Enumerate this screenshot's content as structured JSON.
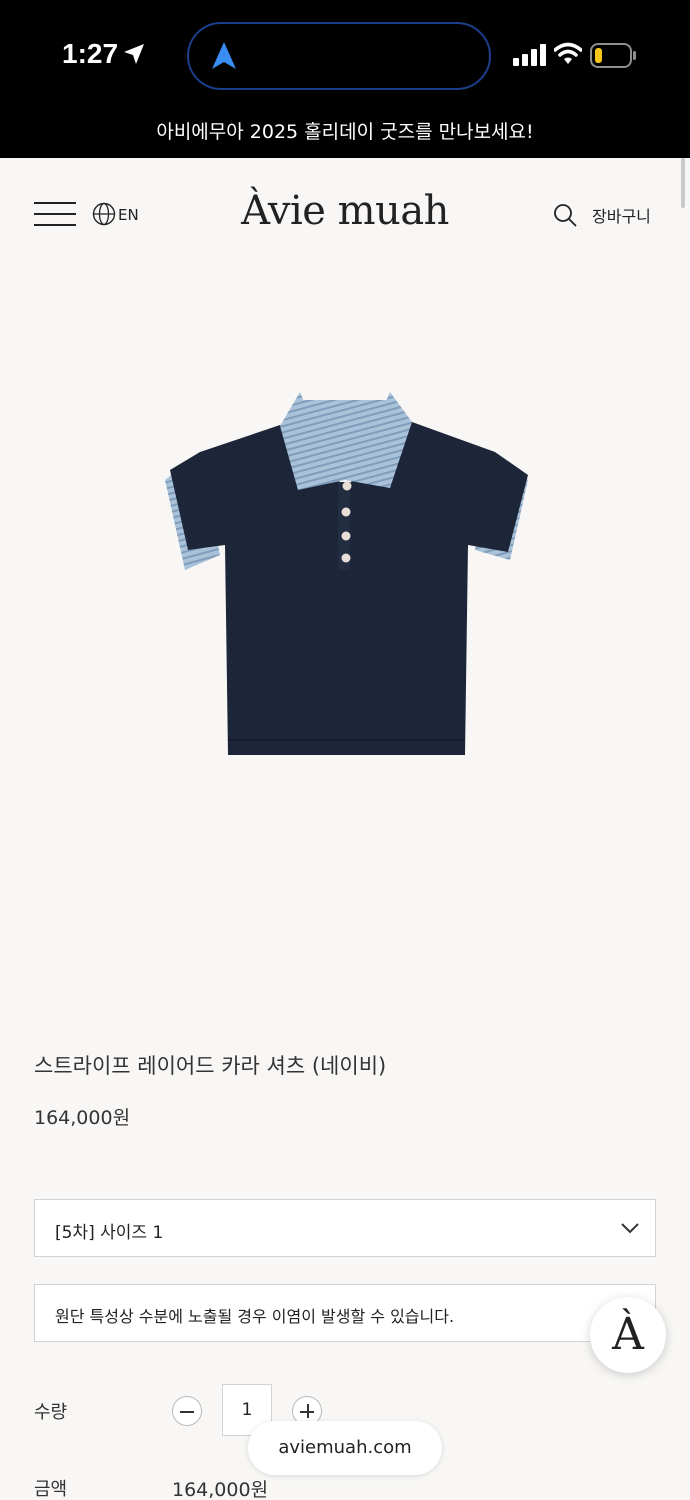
{
  "status_bar": {
    "time": "1:27",
    "icons": [
      "location-arrow-icon",
      "maps-arrow-icon",
      "signal-icon",
      "wifi-icon",
      "battery-icon"
    ]
  },
  "announcement": "아비에무아 2025 홀리데이 굿즈를 만나보세요!",
  "header": {
    "language": "EN",
    "logo": "Àvie muah",
    "cart": "장바구니"
  },
  "product": {
    "name": "스트라이프 레이어드 카라 셔츠 (네이비)",
    "price": "164,000원",
    "option_selected": "[5차] 사이즈 1",
    "notice": "원단 특성상 수분에 노출될 경우 이염이 발생할 수 있습니다."
  },
  "quantity": {
    "label": "수량",
    "value": "1"
  },
  "total": {
    "label": "금액",
    "value": "164,000원"
  },
  "fab_logo": "À",
  "url": "aviemuah.com",
  "colors": {
    "background": "#f8f7f5",
    "announcement_bg": "#000000",
    "shirt_navy": "#1d2638",
    "stripe_blue": "#a9c2da"
  }
}
